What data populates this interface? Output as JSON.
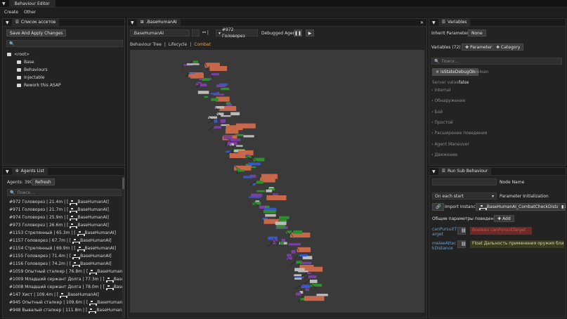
{
  "window": {
    "tab_title": "Behaviour Editor"
  },
  "menu": {
    "items": [
      "Create",
      "Other"
    ]
  },
  "assets": {
    "title": "Список ассетов",
    "save_label": "Save And Apply Changes",
    "search_placeholder": "",
    "root": "<root>",
    "folders": [
      "Base",
      "Behaviours",
      "Injectable",
      "Rework this ASAP"
    ]
  },
  "agents": {
    "title": "Agents List",
    "count_label": "Agents: 390",
    "refresh_label": "Refresh",
    "search_placeholder": "Поиск...",
    "rows": [
      {
        "text": "#972 Головорез | 21.4m |",
        "ai": ".BaseHumanAI]"
      },
      {
        "text": "#971 Головорез | 21.7m |",
        "ai": ".BaseHumanAI]"
      },
      {
        "text": "#974 Головорез | 25.9m |",
        "ai": ".BaseHumanAI]"
      },
      {
        "text": "#973 Головорез | 26.6m |",
        "ai": ".BaseHumanAI]"
      },
      {
        "text": "#1153 Стрелянный | 65.3m |",
        "ai": ".BaseHumanAI]"
      },
      {
        "text": "#1157 Головорез | 67.7m |",
        "ai": ".BaseHumanAI]"
      },
      {
        "text": "#1154 Стрелянный | 69.9m |",
        "ai": ".BaseHumanAI]"
      },
      {
        "text": "#1155 Головорез | 71.4m |",
        "ai": ".BaseHumanAI]"
      },
      {
        "text": "#1156 Головорез | 74.2m |",
        "ai": ".BaseHumanAI]"
      },
      {
        "text": "#1059 Опытный сталкер | 76.8m |",
        "ai": ".BaseHumanAI]"
      },
      {
        "text": "#1009 Младший сержант Долга | 77.3m |",
        "ai": ".BaseHumanAI]"
      },
      {
        "text": "#1008 Младший сержант Долга | 78.0m |",
        "ai": ".BaseHumanAI]"
      },
      {
        "text": "#147 Хист | 109.4m |",
        "ai": ".BaseHumanAI]"
      },
      {
        "text": "#945 Опытный сталкер | 109.6m |",
        "ai": ".BaseHumanAI]"
      },
      {
        "text": "#948 Вывалый сталкер | 111.8m |",
        "ai": ".BaseHumanAI]"
      }
    ]
  },
  "center": {
    "tab_title": ".BaseHumanAI",
    "ai_field": ".BaseHumanAI",
    "agent_select": "#972 Головорез",
    "debugged_label": "Debugged Agent",
    "breadcrumb": [
      "Behaviour Tree",
      "Lifecycle",
      "Combat"
    ]
  },
  "variables": {
    "title": "Variables",
    "inherit_label": "Inherit Parameters:",
    "inherit_value": "None",
    "count_label": "Variables (72)",
    "add_param": "Parameter",
    "add_category": "Category",
    "search_placeholder": "Поиск...",
    "selected_var": "isStateDebugOn",
    "selected_type": "Boolean",
    "server_label": "Server value:",
    "server_value": "false",
    "sections": [
      "Internal",
      "Обнаружение",
      "Бой",
      "Простой",
      "Расширение поведения",
      "Agent Maneuver",
      "Движение"
    ]
  },
  "sub": {
    "title": "Run Sub Behaviour",
    "node_name_label": "Node Name",
    "on_start": "On each start",
    "param_init": "Parameter Initialization",
    "import_label": "Import Instance",
    "import_value": ".BaseHumanAI_CombatCheckDistance",
    "common_label": "Общие параметры поведения (2)",
    "add_label": "Add",
    "param1_name": "canPursuitT arget",
    "param1_value": "Boolean canPursuitTarget",
    "param2_name": "meleeAttac kDistance",
    "param2_value": "Float Дальность применения оружия ближнего б"
  },
  "colors": {
    "accent": "#c8684a",
    "green": "#2f8f2f",
    "purple": "#7a3fa0",
    "blue": "#3a56c8"
  }
}
